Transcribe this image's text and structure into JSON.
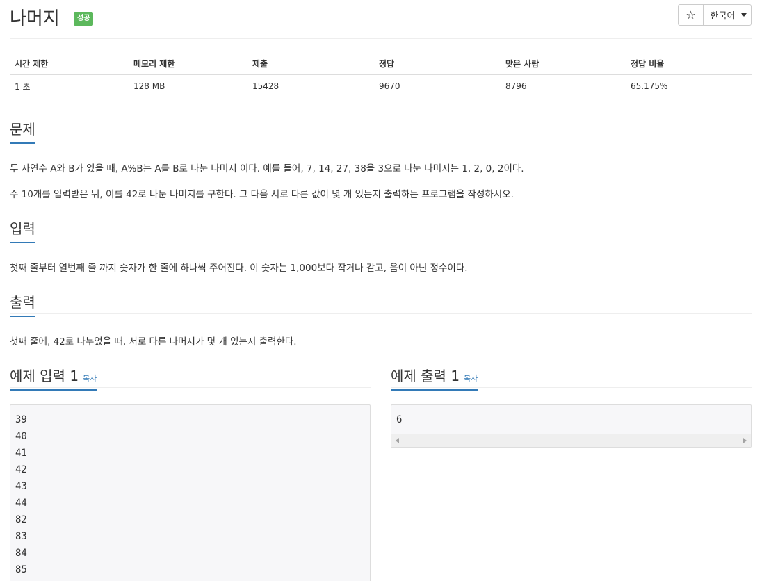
{
  "header": {
    "title": "나머지",
    "badge": "성공",
    "star_icon": "☆",
    "language": "한국어"
  },
  "stats": {
    "headers": [
      "시간 제한",
      "메모리 제한",
      "제출",
      "정답",
      "맞은 사람",
      "정답 비율"
    ],
    "values": [
      "1 초",
      "128 MB",
      "15428",
      "9670",
      "8796",
      "65.175%"
    ]
  },
  "problem": {
    "title": "문제",
    "lines": [
      "두 자연수 A와 B가 있을 때, A%B는 A를 B로 나눈 나머지 이다. 예를 들어, 7, 14, 27, 38을 3으로 나눈 나머지는 1, 2, 0, 2이다.",
      "수 10개를 입력받은 뒤, 이를 42로 나눈 나머지를 구한다. 그 다음 서로 다른 값이 몇 개 있는지 출력하는 프로그램을 작성하시오."
    ]
  },
  "input": {
    "title": "입력",
    "text": "첫째 줄부터 열번째 줄 까지 숫자가 한 줄에 하나씩 주어진다. 이 숫자는 1,000보다 작거나 같고, 음이 아닌 정수이다."
  },
  "output": {
    "title": "출력",
    "text": "첫째 줄에, 42로 나누었을 때, 서로 다른 나머지가 몇 개 있는지 출력한다."
  },
  "sample_input": {
    "title": "예제 입력 1",
    "copy_label": "복사",
    "lines": [
      "39",
      "40",
      "41",
      "42",
      "43",
      "44",
      "82",
      "83",
      "84",
      "85"
    ]
  },
  "sample_output": {
    "title": "예제 출력 1",
    "copy_label": "복사",
    "lines": [
      "6"
    ]
  },
  "colors": {
    "badge": "#5cb85c",
    "accent": "#337ab7"
  }
}
